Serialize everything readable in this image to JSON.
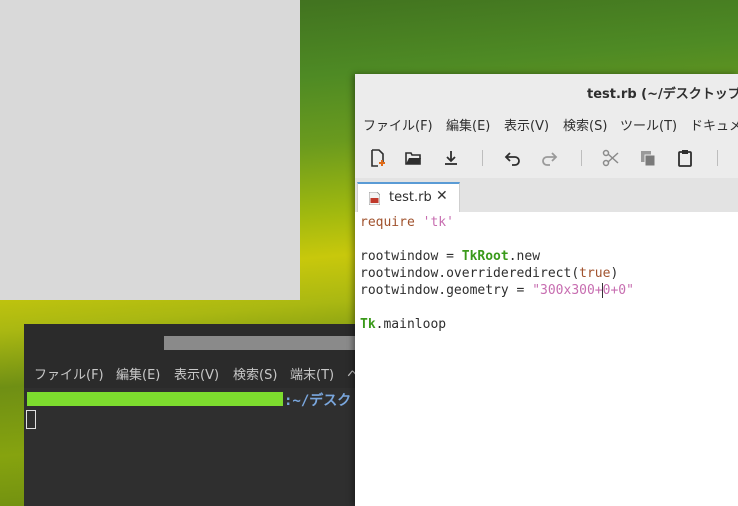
{
  "tk_window": {},
  "terminal": {
    "menu": [
      "ファイル(F)",
      "編集(E)",
      "表示(V)",
      "検索(S)",
      "端末(T)",
      "ヘ"
    ],
    "prompt_path": ":~/デスク"
  },
  "editor": {
    "title": "test.rb (~/デスクトップ/l",
    "menu": [
      "ファイル(F)",
      "編集(E)",
      "表示(V)",
      "検索(S)",
      "ツール(T)",
      "ドキュメ"
    ],
    "tab_label": "test.rb",
    "tab_close": "✕",
    "code": {
      "l1_kw": "require",
      "l1_str": "'tk'",
      "l3_var": "rootwindow = ",
      "l3_cls": "TkRoot",
      "l3_rest": ".new",
      "l4_var": "rootwindow.overrideredirect(",
      "l4_bool": "true",
      "l4_end": ")",
      "l5_var": "rootwindow.geometry = ",
      "l5_str_a": "\"300x300+",
      "l5_str_b": "0+0\"",
      "l7_cls": "Tk",
      "l7_rest": ".mainloop"
    }
  },
  "colors": {
    "accent": "#5a9bd5",
    "prompt_green": "#7ddc2e",
    "prompt_blue": "#7aa7de"
  }
}
